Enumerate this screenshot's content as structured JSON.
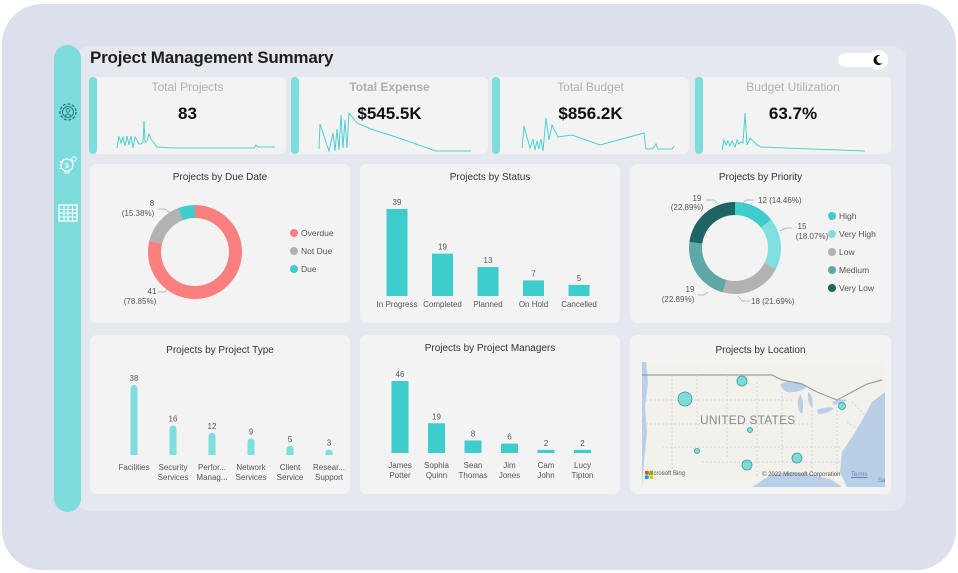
{
  "header": {
    "title": "Project Management Summary",
    "theme_toggle_icon": "moon-icon"
  },
  "sidebar": {
    "items": [
      {
        "name": "project-overview",
        "icon": "gear-person-icon"
      },
      {
        "name": "budget",
        "icon": "money-bulb-icon"
      },
      {
        "name": "table-view",
        "icon": "table-grid-icon"
      }
    ]
  },
  "colors": {
    "accent": "#7fdcdc",
    "bar": "#3ecccc",
    "type_bar": "#7edddd",
    "overdue": "#fa7f7f",
    "not_due": "#b2b2b2",
    "due": "#3ecccc",
    "high": "#3ecccc",
    "very_high": "#80dfdf",
    "low": "#b2b2b2",
    "medium": "#5ea8a8",
    "very_low": "#1f6464"
  },
  "kpis": [
    {
      "label": "Total Projects",
      "value": "83"
    },
    {
      "label": "Total Expense",
      "value": "$545.5K"
    },
    {
      "label": "Total Budget",
      "value": "$856.2K"
    },
    {
      "label": "Budget Utilization",
      "value": "63.7%"
    }
  ],
  "chart_data": [
    {
      "id": "due_date",
      "type": "pie",
      "title": "Projects by Due Date",
      "categories": [
        "Overdue",
        "Not Due",
        "Due"
      ],
      "values": [
        41,
        8,
        3
      ],
      "labels": [
        {
          "value": "41",
          "pct": "(78.85%)"
        },
        {
          "value": "8",
          "pct": "(15.38%)"
        }
      ],
      "legend": "right"
    },
    {
      "id": "status",
      "type": "bar",
      "title": "Projects by Status",
      "categories": [
        "In Progress",
        "Completed",
        "Planned",
        "On Hold",
        "Cancelled"
      ],
      "values": [
        39,
        19,
        13,
        7,
        5
      ]
    },
    {
      "id": "priority",
      "type": "pie",
      "title": "Projects by Priority",
      "categories": [
        "High",
        "Very High",
        "Low",
        "Medium",
        "Very Low"
      ],
      "values": [
        12,
        15,
        18,
        19,
        19
      ],
      "labels": [
        {
          "value": "12",
          "pct": "(14.46%)"
        },
        {
          "value": "15",
          "pct": "(18.07%)"
        },
        {
          "value": "18",
          "pct": "(21.69%)"
        },
        {
          "value": "19",
          "pct": "(22.89%)"
        },
        {
          "value": "19",
          "pct": "(22.89%)"
        }
      ],
      "legend": "right"
    },
    {
      "id": "project_type",
      "type": "bar",
      "title": "Projects by Project Type",
      "categories": [
        "Facilities|",
        "Security|Services",
        "Perfor...|Manag...",
        "Network|Services",
        "Client|Service",
        "Resear...|Support"
      ],
      "values": [
        38,
        16,
        12,
        9,
        5,
        3
      ]
    },
    {
      "id": "managers",
      "type": "bar",
      "title": "Projects by Project Managers",
      "categories": [
        "James|Potter",
        "Sophia|Quinn",
        "Sean|Thomas",
        "Jim|Jones",
        "Cam|John",
        "Lucy|Tipton"
      ],
      "values": [
        46,
        19,
        8,
        6,
        2,
        2
      ]
    }
  ],
  "map": {
    "title": "Projects by Location",
    "country_label": "UNITED STATES",
    "brand": "Microsoft Bing",
    "copyright": "© 2022 Microsoft Corporation",
    "terms": "Terms",
    "corner": "Sa",
    "bubbles": [
      {
        "region": "Idaho/Montana",
        "size": "large"
      },
      {
        "region": "North Dakota",
        "size": "medium"
      },
      {
        "region": "New York",
        "size": "small"
      },
      {
        "region": "Kansas",
        "size": "tiny"
      },
      {
        "region": "Arizona",
        "size": "tiny"
      },
      {
        "region": "Texas",
        "size": "medium"
      },
      {
        "region": "Alabama",
        "size": "medium"
      }
    ]
  }
}
